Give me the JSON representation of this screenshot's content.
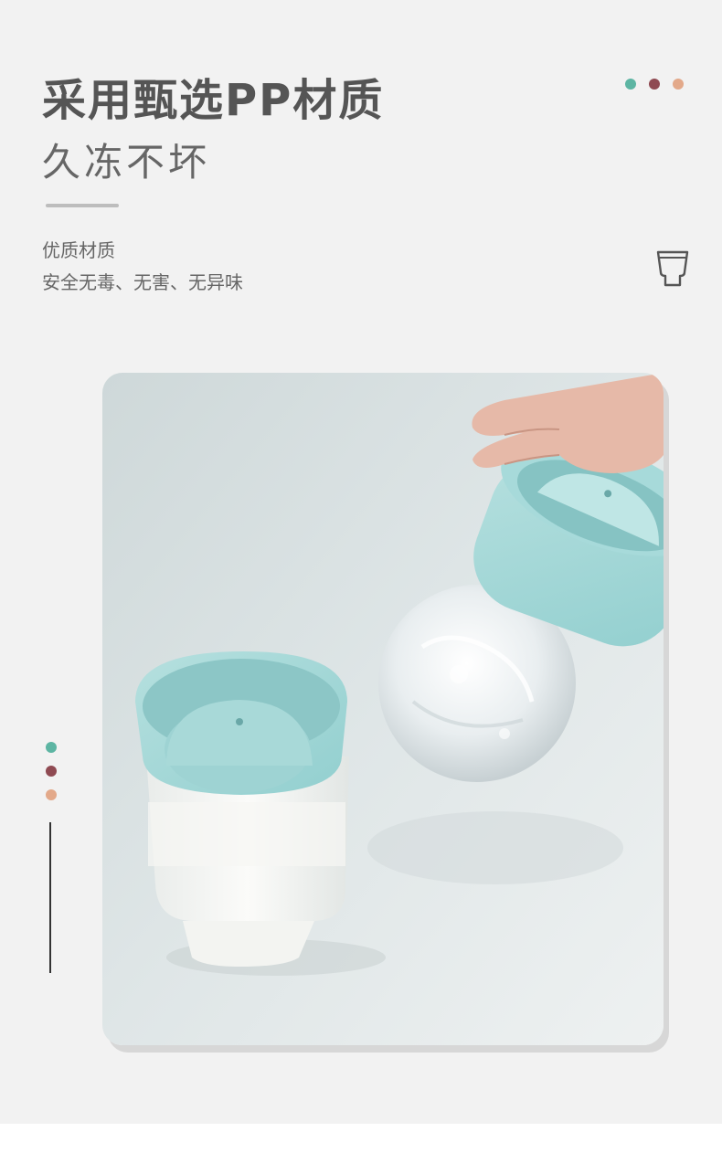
{
  "header": {
    "title": "采用甄选PP材质",
    "subtitle": "久冻不坏"
  },
  "feature": {
    "title": "优质材质",
    "description": "安全无毒、无害、无异味"
  },
  "palette": {
    "teal": "#5db5a3",
    "maroon": "#8f4a52",
    "peach": "#e3a98a",
    "mold_blue": "#a5d8d8",
    "background": "#f2f2f2"
  },
  "icons": {
    "feature_icon": "cup-icon"
  },
  "photo": {
    "subject": "ice-ball-mold-product-photo"
  }
}
